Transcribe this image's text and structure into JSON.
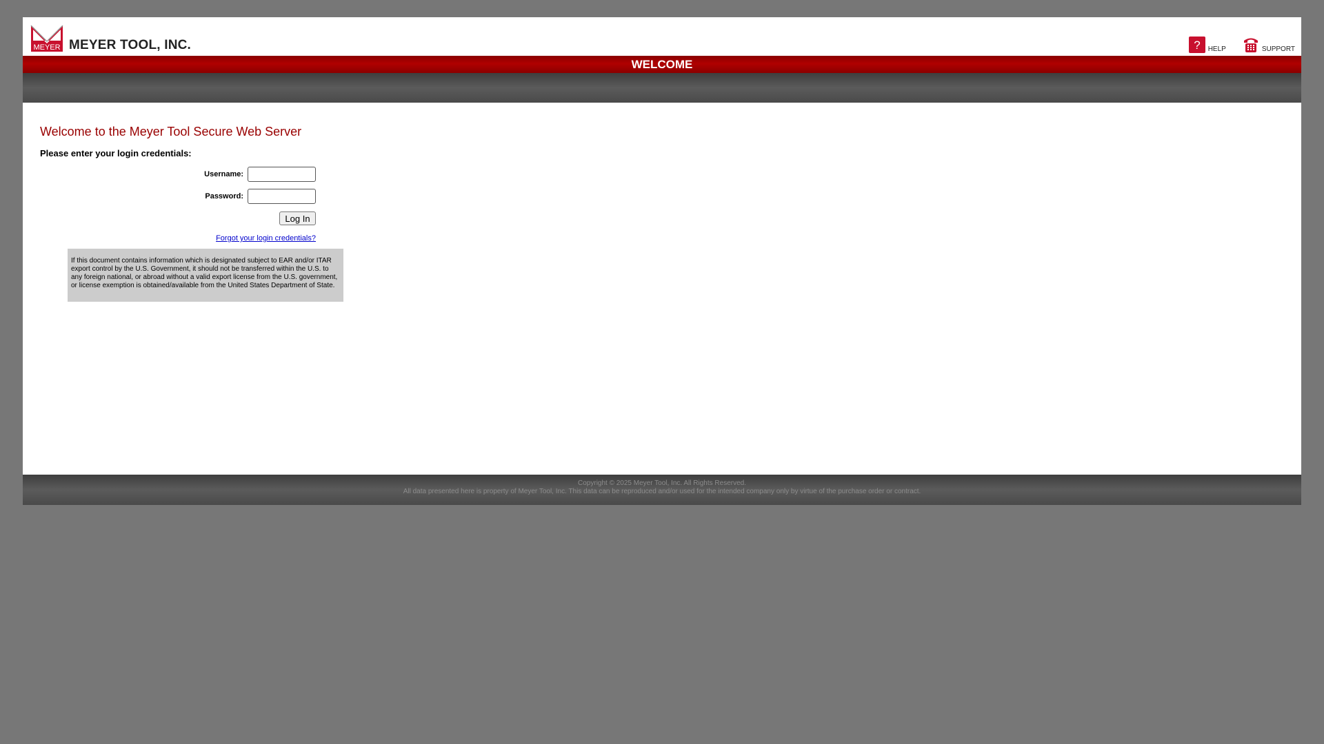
{
  "header": {
    "logo_mark_text": "MEYER",
    "company_name": "MEYER TOOL, INC.",
    "help_label": "HELP",
    "support_label": "SUPPORT",
    "help_icon": "question-mark-icon",
    "support_icon": "phone-icon"
  },
  "titlebar": {
    "title": "WELCOME"
  },
  "main": {
    "welcome_heading": "Welcome to the Meyer Tool Secure Web Server",
    "prompt": "Please enter your login credentials:",
    "username_label": "Username:",
    "username_value": "",
    "password_label": "Password:",
    "password_value": "",
    "login_button": "Log In",
    "forgot_link": "Forgot your login credentials?",
    "notice": "If this document contains information which is designated subject to EAR and/or ITAR export control by the U.S. Government, it should not be transferred within the U.S. to any foreign national, or abroad without a valid export license from the U.S. government, or license exemption is obtained/available from the United States Department of State."
  },
  "footer": {
    "copyright": "Copyright © 2025 Meyer Tool, Inc. All Rights Reserved.",
    "disclaimer": "All data presented here is property of Meyer Tool, Inc. This data can be reproduced and/or used for the intended company only by virtue of the purchase order or contract."
  },
  "colors": {
    "brand_red": "#990000",
    "page_background": "#777777",
    "link_blue": "#0000cc"
  }
}
